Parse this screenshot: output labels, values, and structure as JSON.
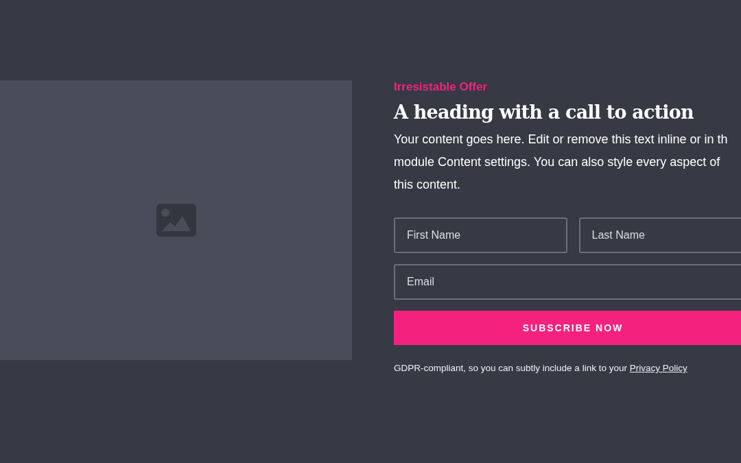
{
  "eyebrow": "Irresistable Offer",
  "heading": "A heading with a call to action",
  "body_lines": [
    "Your content goes here. Edit or remove this text inline or in th",
    "module Content settings. You can also style every aspect of",
    "this content."
  ],
  "form": {
    "rows": [
      [
        {
          "placeholder": "First Name"
        },
        {
          "placeholder": "Last Name"
        }
      ],
      [
        {
          "placeholder": "Email"
        }
      ]
    ],
    "button": "SUBSCRIBE NOW"
  },
  "note": {
    "text": "GDPR-compliant, so you can subtly include a link to your ",
    "link": "Privacy Policy"
  }
}
